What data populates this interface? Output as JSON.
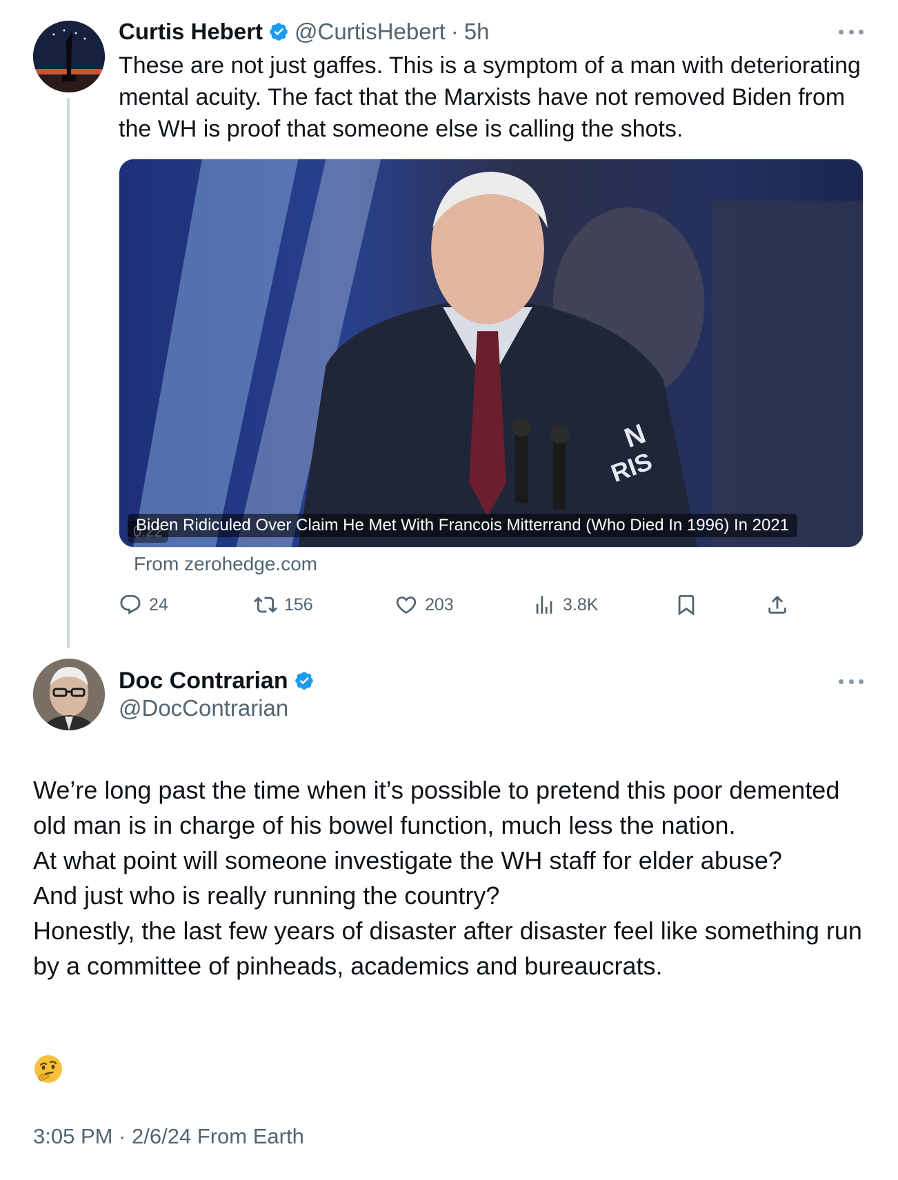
{
  "tweet": {
    "author_name": "Curtis Hebert",
    "author_handle": "@CurtisHebert",
    "separator": "·",
    "time": "5h",
    "text": "These are not just gaffes. This is a symptom of a man with deteriorating mental acuity. The fact that the Marxists have not removed Biden from the WH is proof that someone else is calling the shots.",
    "media": {
      "caption": "Biden Ridiculed Over Claim He Met With Francois Mitterrand (Who Died In 1996) In 2021",
      "duration": "0:22",
      "sign_text": "N\nRIS"
    },
    "source": "From zerohedge.com",
    "stats": {
      "replies": "24",
      "retweets": "156",
      "likes": "203",
      "views": "3.8K"
    }
  },
  "reply": {
    "author_name": "Doc Contrarian",
    "author_handle": "@DocContrarian",
    "paragraphs": [
      "We’re long past the time when it’s possible to pretend this poor demented old man is in charge of his bowel function, much less the nation.",
      "At what point will someone investigate the WH staff for elder abuse?",
      "And just who is really running the country?",
      "Honestly, the last few years of disaster after disaster feel like something run by a committee of pinheads, academics and bureaucrats."
    ],
    "emoji": "thinking-face",
    "meta": "3:05 PM · 2/6/24 From Earth"
  },
  "colors": {
    "text": "#0f1419",
    "secondary": "#536471",
    "verified": "#1d9bf0",
    "thread_line": "#cfd9de"
  },
  "icons": [
    "reply-icon",
    "retweet-icon",
    "like-icon",
    "views-icon",
    "bookmark-icon",
    "share-icon",
    "more-icon",
    "verified-badge-icon"
  ]
}
